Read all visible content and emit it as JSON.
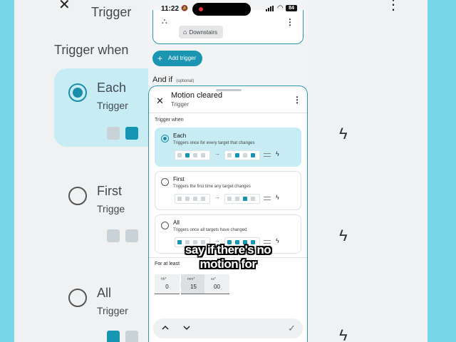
{
  "status_bar": {
    "time": "11:22",
    "battery": "84"
  },
  "background": {
    "trigger_when": "Trigger when",
    "each": "Each",
    "triggers_each": "Trigger",
    "first": "First",
    "triggers_first": "Trigge",
    "all": "All",
    "triggers_all": "Trigger"
  },
  "previous_trigger": {
    "chip_label": "Downstairs"
  },
  "add_trigger_label": "Add trigger",
  "and_if": {
    "label": "And if",
    "note": "(optional)"
  },
  "sheet": {
    "title": "Motion cleared",
    "subtitle": "Trigger",
    "trigger_when_label": "Trigger when",
    "options": [
      {
        "name": "Each",
        "description": "Triggers once for every target that changes",
        "selected": true
      },
      {
        "name": "First",
        "description": "Triggers the first time any target changes",
        "selected": false
      },
      {
        "name": "All",
        "description": "Triggers once all targets have changed",
        "selected": false
      }
    ],
    "for_at_least_label": "For at least",
    "duration": {
      "hours_label": "hh*",
      "hours": "0",
      "minutes_label": "mm*",
      "minutes": "15",
      "seconds_label": "ss*",
      "seconds": "00"
    }
  },
  "caption": {
    "line1": "say if there's no",
    "line2": "motion for"
  },
  "colors": {
    "accent": "#1b95b2",
    "selected_bg": "#c8ecf3",
    "background": "#59c9e0"
  },
  "icons": [
    "close-icon",
    "more-vert-icon",
    "home-icon",
    "plus-icon",
    "bolt-icon",
    "arrow-right-icon",
    "chevron-up-icon",
    "chevron-down-icon",
    "check-icon",
    "wifi-icon",
    "signal-icon",
    "bell-off-icon"
  ]
}
